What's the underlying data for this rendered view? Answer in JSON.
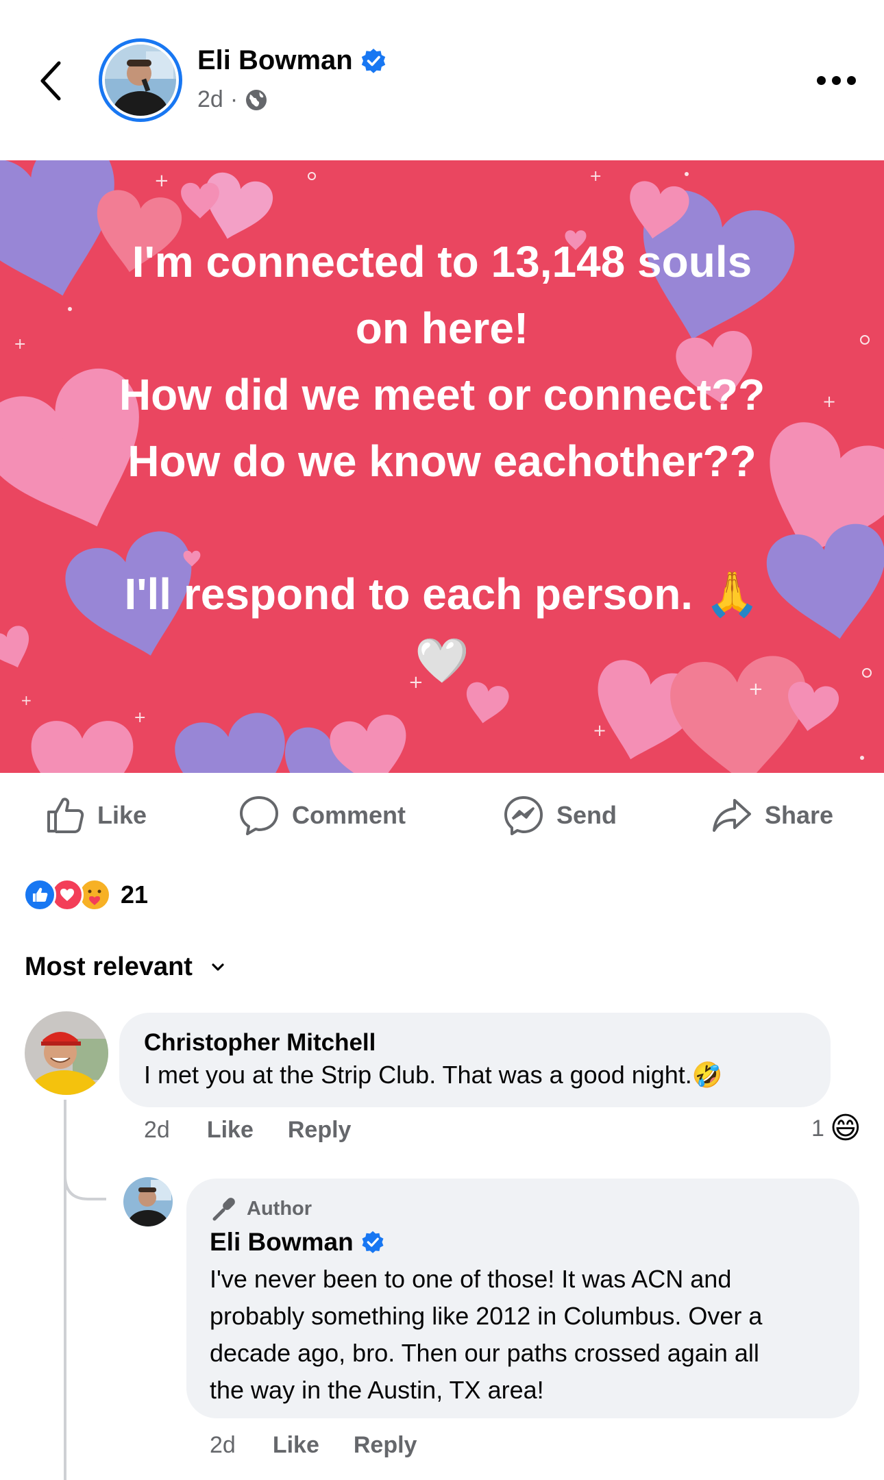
{
  "header": {
    "author_name": "Eli Bowman",
    "time": "2d",
    "separator": "·",
    "icons": [
      "back-chevron-icon",
      "verified-badge-icon",
      "globe-icon",
      "more-dots-icon"
    ]
  },
  "post": {
    "lines": [
      "I'm connected to 13,148 souls",
      "on here!",
      "How did we meet or connect??",
      "How do we know eachother??",
      "",
      "I'll respond to each person. 🙏",
      "🤍"
    ],
    "background_color": "#ea4660"
  },
  "actions": {
    "like": "Like",
    "comment": "Comment",
    "send": "Send",
    "share": "Share"
  },
  "reactions": {
    "types": [
      "like",
      "love",
      "care"
    ],
    "count": "21"
  },
  "sort": {
    "label": "Most relevant"
  },
  "comments": [
    {
      "name": "Christopher Mitchell",
      "text": "I met you at the Strip Club. That was a good night.🤣",
      "time": "2d",
      "like_label": "Like",
      "reply_label": "Reply",
      "reaction_count": "1",
      "reaction_emoji": "😄"
    }
  ],
  "reply": {
    "badge": "Author",
    "name": "Eli Bowman",
    "text_lines": [
      "I've never been to one of those! It was ACN and",
      "probably something like 2012 in Columbus. Over a",
      "decade ago, bro. Then our paths crossed again all",
      "the way in the Austin, TX area!"
    ],
    "time": "2d",
    "like_label": "Like",
    "reply_label": "Reply"
  },
  "colors": {
    "facebook_blue": "#1877f2",
    "secondary_text": "#65676b",
    "bubble_bg": "#f0f2f5"
  }
}
